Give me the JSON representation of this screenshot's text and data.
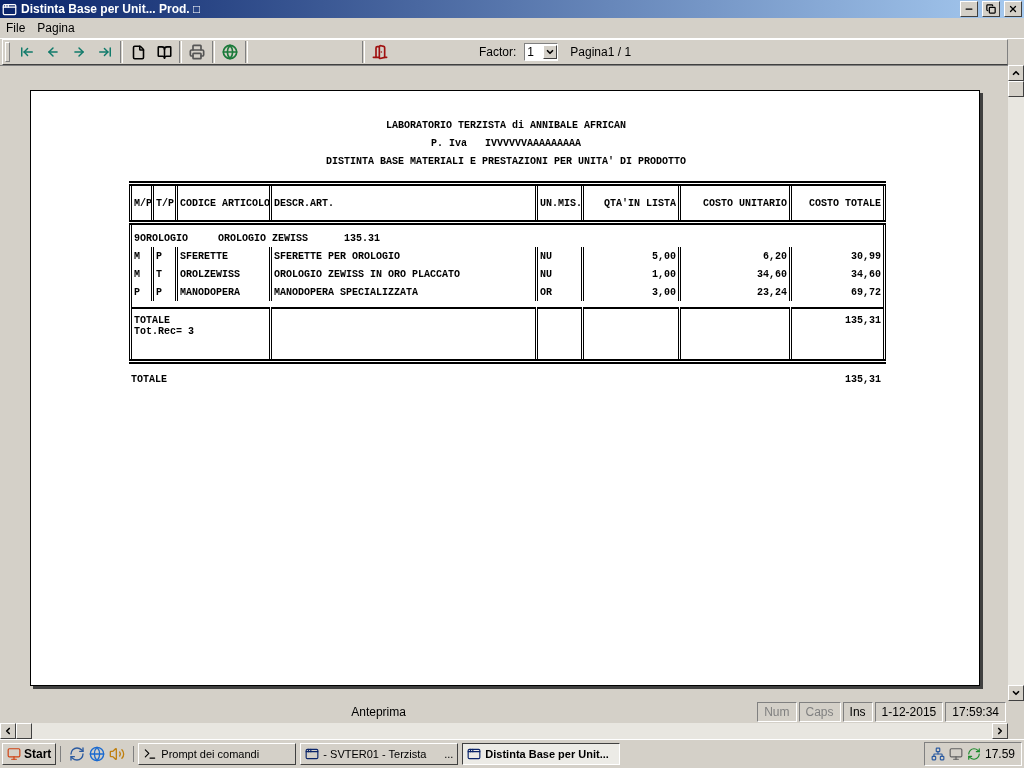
{
  "window": {
    "title": "Distinta Base per Unit... Prod. □"
  },
  "menu": [
    {
      "label": "File"
    },
    {
      "label": "Pagina"
    }
  ],
  "toolbar": {
    "factor_label": "Factor:",
    "factor_value": "1",
    "page_label": "Pagina1 / 1"
  },
  "report": {
    "header_lines": [
      "LABORATORIO TERZISTA di ANNIBALE AFRICAN",
      "P. Iva   IVVVVVVAAAAAAAAA",
      "DISTINTA BASE MATERIALI E PRESTAZIONI PER UNITA' DI PRODOTTO"
    ],
    "columns": [
      {
        "label": "M/P"
      },
      {
        "label": "T/P"
      },
      {
        "label": "CODICE ARTICOLO"
      },
      {
        "label": "DESCR.ART."
      },
      {
        "label": "UN.MIS."
      },
      {
        "label": "QTA'IN LISTA"
      },
      {
        "label": "COSTO UNITARIO"
      },
      {
        "label": "COSTO TOTALE"
      }
    ],
    "group": {
      "code": "9OROLOGIO",
      "description": "OROLOGIO ZEWISS",
      "amount": "135.31"
    },
    "rows": [
      {
        "cells": [
          "M",
          "P",
          "SFERETTE",
          "SFERETTE PER OROLOGIO",
          "NU",
          "5,00",
          "6,20",
          "30,99"
        ]
      },
      {
        "cells": [
          "M",
          "T",
          "OROLZEWISS",
          "OROLOGIO ZEWISS IN ORO PLACCATO",
          "NU",
          "1,00",
          "34,60",
          "34,60"
        ]
      },
      {
        "cells": [
          "P",
          "P",
          "MANODOPERA",
          "MANODOPERA SPECIALIZZATA",
          "OR",
          "3,00",
          "23,24",
          "69,72"
        ]
      }
    ],
    "subtotal": {
      "label": "TOTALE",
      "records": "Tot.Rec= 3",
      "total": "135,31"
    },
    "grand_total": {
      "label": "TOTALE",
      "total": "135,31"
    }
  },
  "status_bar": {
    "message": "Anteprima",
    "indicators": [
      {
        "label": "Num",
        "on": false
      },
      {
        "label": "Caps",
        "on": false
      },
      {
        "label": "Ins",
        "on": true
      }
    ],
    "date": "1-12-2015",
    "time": "17:59:34"
  },
  "taskbar": {
    "start": "Start",
    "tasks": [
      {
        "label": "Prompt dei comandi",
        "kind": "console",
        "selected": false
      },
      {
        "label": "- SVTER01 - Terzista",
        "kind": "window",
        "selected": false,
        "suffix": "..."
      },
      {
        "label": "Distinta Base per Unit...",
        "kind": "window",
        "selected": true
      }
    ],
    "clock": "17.59"
  }
}
